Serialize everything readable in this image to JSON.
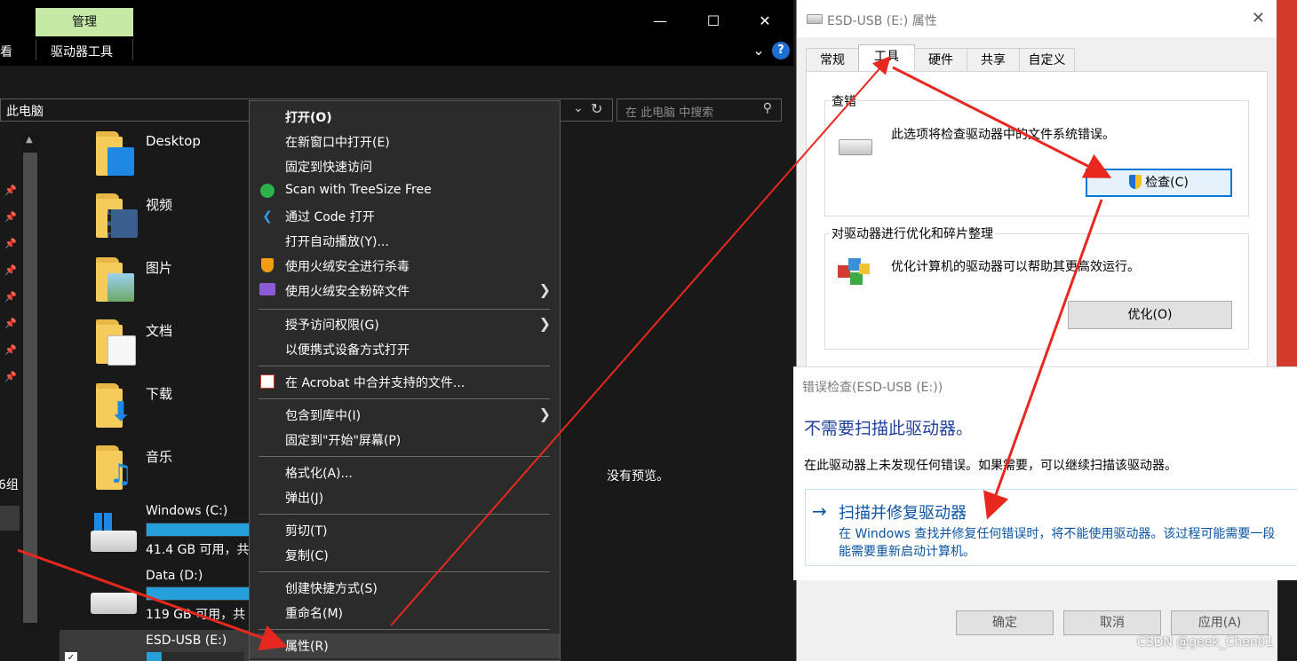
{
  "explorer": {
    "ribbon": {
      "context_tab": "管理",
      "tab_view_partial": "查看",
      "tab_drive_tools": "驱动器工具",
      "help": "?"
    },
    "address": "此电脑",
    "search_placeholder": "在 此电脑 中搜索",
    "items": [
      {
        "label": "Desktop"
      },
      {
        "label": "视频"
      },
      {
        "label": "图片"
      },
      {
        "label": "文档"
      },
      {
        "label": "下载"
      },
      {
        "label": "音乐"
      }
    ],
    "drives": [
      {
        "label": "Windows (C:)",
        "free": "41.4 GB 可用，共",
        "usage": 0.9
      },
      {
        "label": "Data (D:)",
        "free": "119 GB 可用，共",
        "usage": 0.8
      },
      {
        "label": "ESD-USB (E:)",
        "free": "",
        "usage": 0.15
      }
    ],
    "nav_partial_text": "6组",
    "preview_text": "没有预览。"
  },
  "context_menu": {
    "items": [
      {
        "label": "打开(O)",
        "bold": true
      },
      {
        "label": "在新窗口中打开(E)"
      },
      {
        "label": "固定到快速访问"
      },
      {
        "label": "Scan with TreeSize Free",
        "icon": "treesize-icon"
      },
      {
        "label": "通过 Code 打开",
        "icon": "vscode-icon"
      },
      {
        "label": "打开自动播放(Y)..."
      },
      {
        "label": "使用火绒安全进行杀毒",
        "icon": "huorong-shield-icon"
      },
      {
        "label": "使用火绒安全粉碎文件",
        "icon": "huorong-shred-icon",
        "submenu": true
      },
      {
        "label": "授予访问权限(G)",
        "submenu": true
      },
      {
        "label": "以便携式设备方式打开"
      },
      {
        "label": "在 Acrobat 中合并支持的文件...",
        "icon": "acrobat-icon"
      },
      {
        "label": "包含到库中(I)",
        "submenu": true
      },
      {
        "label": "固定到\"开始\"屏幕(P)"
      },
      {
        "label": "格式化(A)..."
      },
      {
        "label": "弹出(J)"
      },
      {
        "label": "剪切(T)"
      },
      {
        "label": "复制(C)"
      },
      {
        "label": "创建快捷方式(S)"
      },
      {
        "label": "重命名(M)"
      },
      {
        "label": "属性(R)"
      }
    ]
  },
  "properties": {
    "title": "ESD-USB (E:) 属性",
    "tabs": [
      "常规",
      "工具",
      "硬件",
      "共享",
      "自定义"
    ],
    "active_tab": "工具",
    "check_group": {
      "title": "查错",
      "text": "此选项将检查驱动器中的文件系统错误。",
      "button": "检查(C)"
    },
    "optimize_group": {
      "title": "对驱动器进行优化和碎片整理",
      "text": "优化计算机的驱动器可以帮助其更高效运行。",
      "button": "优化(O)"
    },
    "bottom_buttons": [
      "确定",
      "取消",
      "应用(A)"
    ]
  },
  "error_check": {
    "title": "错误检查(ESD-USB (E:))",
    "heading": "不需要扫描此驱动器。",
    "message": "在此驱动器上未发现任何错误。如果需要，可以继续扫描该驱动器。",
    "link_title": "扫描并修复驱动器",
    "link_desc_1": "在 Windows 查找并修复任何错误时，将不能使用驱动器。该过程可能需要一段",
    "link_desc_2": "能需要重新启动计算机。",
    "arrow_glyph": "→"
  },
  "watermark": "CSDN @geek_Chen01",
  "colors": {
    "context_tab": "#c7e9a6",
    "menu_bg": "#2b2b2b",
    "link_blue": "#0a54a6",
    "annotation_red": "#e8281e",
    "drive_bar": "#26a0da"
  }
}
